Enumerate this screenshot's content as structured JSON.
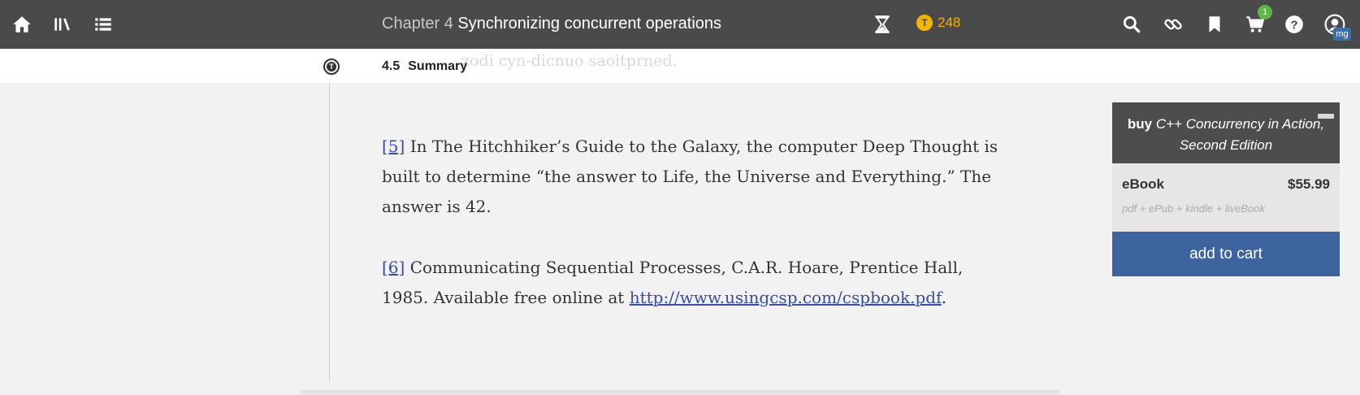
{
  "topbar": {
    "chapter_prefix": "Chapter 4",
    "chapter_title": "Synchronizing concurrent operations",
    "coins": "248",
    "coin_symbol": "T",
    "cart_count": "1",
    "avatar_initials": "mg",
    "icons": [
      "home-icon",
      "library-icon",
      "toc-icon",
      "hourglass-icon",
      "search-icon",
      "link-icon",
      "bookmark-icon",
      "cart-icon",
      "help-icon",
      "user-icon"
    ]
  },
  "subbar": {
    "section_icon_symbol": "T",
    "section_number": "4.5",
    "section_title": "Summary",
    "ghost_text": "zodi cyn-dicnuo saoitprned."
  },
  "content": {
    "footnote5": {
      "ref": "[5]",
      "text": " In The Hitchhiker’s Guide to the Galaxy, the computer Deep Thought is built to determine “the answer to Life, the Universe and Everything.” The answer is 42."
    },
    "footnote6": {
      "ref": "[6]",
      "text_before": " Communicating Sequential Processes, C.A.R. Hoare, Prentice Hall, 1985. Available free online at ",
      "link": "http://www.usingcsp.com/cspbook.pdf",
      "text_after": "."
    }
  },
  "buybox": {
    "buy_word": "buy",
    "book_title": "C++ Concurrency in Action, Second Edition",
    "format": "eBook",
    "price": "$55.99",
    "formats": "pdf + ePub + kindle + liveBook",
    "add_to_cart": "add to cart"
  },
  "colors": {
    "topbar_bg": "#4a4a4a",
    "coin": "#f4b400",
    "cart_badge": "#5fb548",
    "add_to_cart": "#3e64a0",
    "link": "#3b4ba8"
  }
}
